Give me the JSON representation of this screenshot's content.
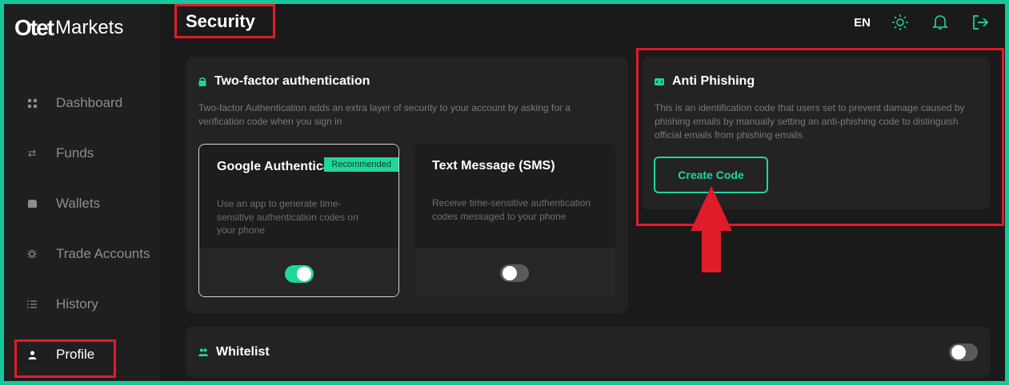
{
  "brand": {
    "logo_mark": "Otet",
    "logo_text": "Markets"
  },
  "sidebar": {
    "items": [
      {
        "label": "Dashboard",
        "icon": "grid-icon"
      },
      {
        "label": "Funds",
        "icon": "transfer-arrows-icon"
      },
      {
        "label": "Wallets",
        "icon": "wallet-icon"
      },
      {
        "label": "Trade Accounts",
        "icon": "gear-icon"
      },
      {
        "label": "History",
        "icon": "list-icon"
      },
      {
        "label": "Profile",
        "icon": "user-icon",
        "active": true
      }
    ]
  },
  "header": {
    "title": "Security",
    "language": "EN",
    "icons": [
      "sun-icon",
      "bell-icon",
      "logout-icon"
    ]
  },
  "two_factor": {
    "title": "Two-factor authentication",
    "description": "Two-factor Authentication adds an extra layer of security to your account by asking for a verification code when you sign in",
    "methods": [
      {
        "title": "Google Authenticator",
        "badge": "Recommended",
        "description": "Use an app to generate time-sensitive authentication codes on your phone",
        "enabled": true
      },
      {
        "title": "Text Message (SMS)",
        "description": "Receive time-sensitive authentication codes messaged to your phone",
        "enabled": false
      }
    ]
  },
  "anti_phishing": {
    "title": "Anti Phishing",
    "description": "This is an identification code that users set to prevent damage caused by phishing emails by manually setting an anti-phishing code to distinguish official emails from phishing emails",
    "button_label": "Create Code"
  },
  "whitelist": {
    "title": "Whitelist",
    "enabled": false
  },
  "colors": {
    "accent": "#21d69a",
    "highlight": "#e01b2a",
    "frame": "#16c79a",
    "background": "#1a1a1a",
    "card": "#232323"
  }
}
